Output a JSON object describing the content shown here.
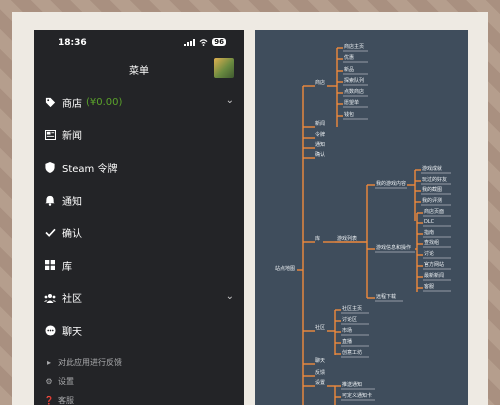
{
  "status_bar": {
    "time": "18:36",
    "battery": "96"
  },
  "header": {
    "title": "菜单"
  },
  "menu": {
    "store": {
      "label": "商店",
      "balance": "(¥0.00)"
    },
    "news": "新闻",
    "guard": "Steam 令牌",
    "notifications": "通知",
    "confirm": "确认",
    "library": "库",
    "community": "社区",
    "chat": "聊天"
  },
  "footer": {
    "feedback": "对此应用进行反馈",
    "settings": "设置",
    "help": "客服"
  },
  "colors": {
    "accent_green": "#5ba32b",
    "connector_orange": "#f08a3c",
    "map_bg": "#3f4d5c",
    "menu_bg": "#232427"
  },
  "mindmap": {
    "root": "站点地图",
    "branches": {
      "store": "商店",
      "news": "新闻",
      "guard": "令牌",
      "notifications": "通知",
      "confirm": "确认",
      "library": "库",
      "community": "社区",
      "chat": "聊天",
      "feedback": "反馈",
      "settings": "设置"
    },
    "store_items": [
      "商店主页",
      "优惠",
      "新品",
      "探索队列",
      "点数商店",
      "愿望单",
      "钱包"
    ],
    "library_games": "游戏列表",
    "library_sub": {
      "my_content": "我的游戏内容",
      "info_ops": "游戏信息和操作",
      "dl": "远程下载"
    },
    "my_content_items": [
      "游戏成就",
      "玩过的好友",
      "我的截图",
      "我的评测"
    ],
    "info_items": [
      "商店页面",
      "DLC",
      "指南",
      "查找组",
      "讨论",
      "官方网站",
      "最新新闻",
      "客服"
    ],
    "community_items": [
      "社区主页",
      "讨论区",
      "市场",
      "直播",
      "创意工坊"
    ],
    "settings_items": [
      "推送通知",
      "可定义通知卡"
    ]
  }
}
